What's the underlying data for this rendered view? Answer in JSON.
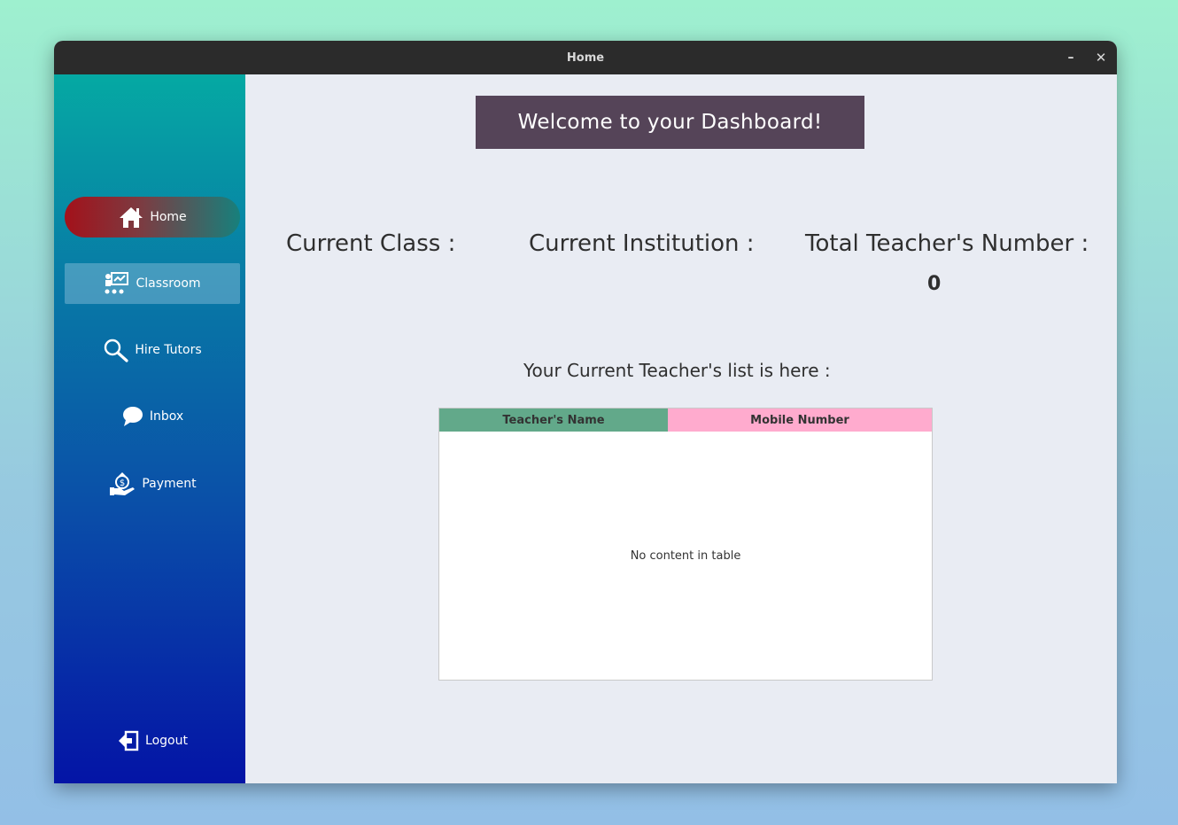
{
  "window": {
    "title": "Home"
  },
  "sidebar": {
    "items": [
      {
        "label": "Home",
        "icon": "home-icon"
      },
      {
        "label": "Classroom",
        "icon": "classroom-icon"
      },
      {
        "label": "Hire Tutors",
        "icon": "search-icon"
      },
      {
        "label": "Inbox",
        "icon": "chat-bubble-icon"
      },
      {
        "label": "Payment",
        "icon": "money-bag-hand-icon"
      }
    ],
    "logout": {
      "label": "Logout",
      "icon": "logout-icon"
    }
  },
  "main": {
    "welcome": "Welcome to your Dashboard!",
    "stats": {
      "current_class_label": "Current Class :",
      "current_institution_label": "Current Institution :",
      "total_teachers_label": "Total Teacher's Number :",
      "total_teachers_value": "0"
    },
    "list_caption": "Your Current Teacher's list is here :",
    "table": {
      "columns": [
        "Teacher's Name",
        "Mobile Number"
      ],
      "empty_text": "No content in table"
    }
  },
  "colors": {
    "titlebar": "#2b2b2b",
    "welcome_bg": "#554458",
    "col_name_bg": "#62a98a",
    "col_mobile_bg": "#ffabce"
  }
}
